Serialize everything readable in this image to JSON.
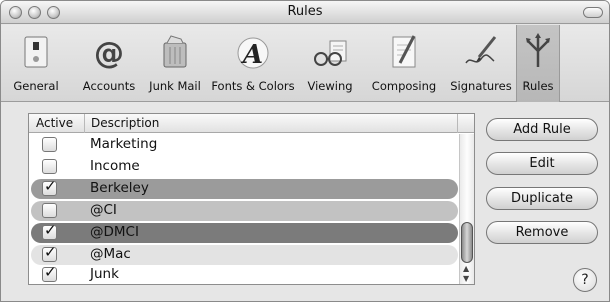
{
  "window": {
    "title": "Rules"
  },
  "toolbar": {
    "items": [
      {
        "label": "General",
        "icon": "general-switch-icon"
      },
      {
        "label": "Accounts",
        "icon": "at-sign-icon"
      },
      {
        "label": "Junk Mail",
        "icon": "trash-can-icon"
      },
      {
        "label": "Fonts & Colors",
        "icon": "font-a-icon"
      },
      {
        "label": "Viewing",
        "icon": "glasses-icon"
      },
      {
        "label": "Composing",
        "icon": "pencil-paper-icon"
      },
      {
        "label": "Signatures",
        "icon": "pen-signature-icon"
      },
      {
        "label": "Rules",
        "icon": "rules-arrows-icon",
        "selected": true
      }
    ]
  },
  "rules_table": {
    "columns": [
      "Active",
      "Description"
    ],
    "rows": [
      {
        "active": false,
        "description": "Marketing",
        "color": ""
      },
      {
        "active": false,
        "description": "Income",
        "color": ""
      },
      {
        "active": true,
        "description": "Berkeley",
        "color": "#9b9b9b"
      },
      {
        "active": false,
        "description": "@CI",
        "color": "#c2c2c2"
      },
      {
        "active": true,
        "description": "@DMCI",
        "color": "#7b7b7b"
      },
      {
        "active": true,
        "description": "@Mac",
        "color": "#e3e3e3"
      },
      {
        "active": true,
        "description": "Junk",
        "color": ""
      }
    ]
  },
  "buttons": {
    "add_rule": "Add Rule",
    "edit": "Edit",
    "duplicate": "Duplicate",
    "remove": "Remove",
    "help": "?"
  },
  "checkmark": "✓"
}
